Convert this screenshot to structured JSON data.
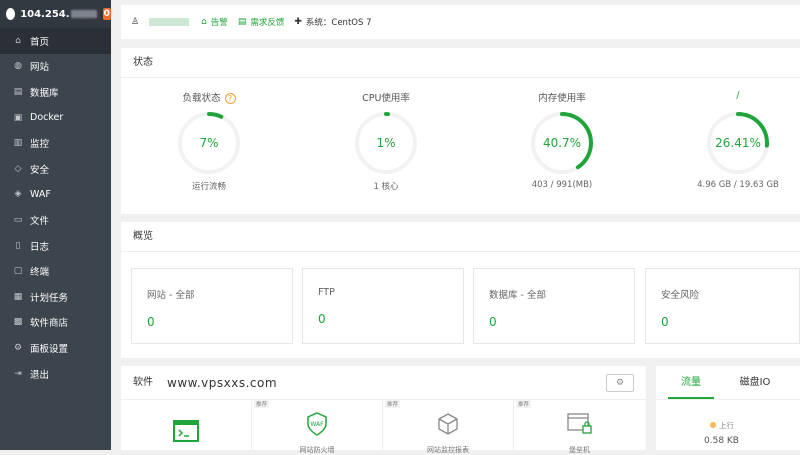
{
  "sidebar": {
    "server_ip": "104.254.",
    "notice_count": "0",
    "items": [
      {
        "label": "首页",
        "icon": "home-icon"
      },
      {
        "label": "网站",
        "icon": "globe-icon"
      },
      {
        "label": "数据库",
        "icon": "database-icon"
      },
      {
        "label": "Docker",
        "icon": "docker-icon"
      },
      {
        "label": "监控",
        "icon": "monitor-icon"
      },
      {
        "label": "安全",
        "icon": "shield-icon"
      },
      {
        "label": "WAF",
        "icon": "waf-icon"
      },
      {
        "label": "文件",
        "icon": "folder-icon"
      },
      {
        "label": "日志",
        "icon": "log-icon"
      },
      {
        "label": "终端",
        "icon": "terminal-icon"
      },
      {
        "label": "计划任务",
        "icon": "task-icon"
      },
      {
        "label": "软件商店",
        "icon": "store-icon"
      },
      {
        "label": "面板设置",
        "icon": "settings-icon"
      },
      {
        "label": "退出",
        "icon": "logout-icon"
      }
    ]
  },
  "topbar": {
    "alert": "告警",
    "feedback": "需求反馈",
    "system": "系统：CentOS 7"
  },
  "status": {
    "title": "状态",
    "gauges": [
      {
        "label": "负载状态",
        "value": "7%",
        "percent": 7,
        "sub": "运行流畅",
        "help": "?"
      },
      {
        "label": "CPU使用率",
        "value": "1%",
        "percent": 1,
        "sub": "1 核心"
      },
      {
        "label": "内存使用率",
        "value": "40.7%",
        "percent": 40.7,
        "sub": "403 / 991(MB)"
      },
      {
        "label": "/",
        "value": "26.41%",
        "percent": 26.41,
        "sub": "4.96 GB / 19.63 GB"
      }
    ]
  },
  "overview": {
    "title": "概览",
    "boxes": [
      {
        "label": "网站 - 全部",
        "value": "0"
      },
      {
        "label": "FTP",
        "value": "0"
      },
      {
        "label": "数据库 - 全部",
        "value": "0"
      },
      {
        "label": "安全风险",
        "value": "0"
      }
    ]
  },
  "software": {
    "title": "软件",
    "watermark": "www.vpsxxs.com",
    "apps": [
      {
        "tag": "",
        "name": ""
      },
      {
        "tag": "推荐",
        "name": "网站防火墙"
      },
      {
        "tag": "推荐",
        "name": "网站监控报表"
      },
      {
        "tag": "推荐",
        "name": "堡垒机"
      }
    ]
  },
  "traffic": {
    "tabs": [
      "流量",
      "磁盘IO"
    ],
    "up_label": "上行",
    "up_value": "0.58 KB"
  },
  "colors": {
    "accent": "#20a53a",
    "sidebar": "#3c444d"
  }
}
